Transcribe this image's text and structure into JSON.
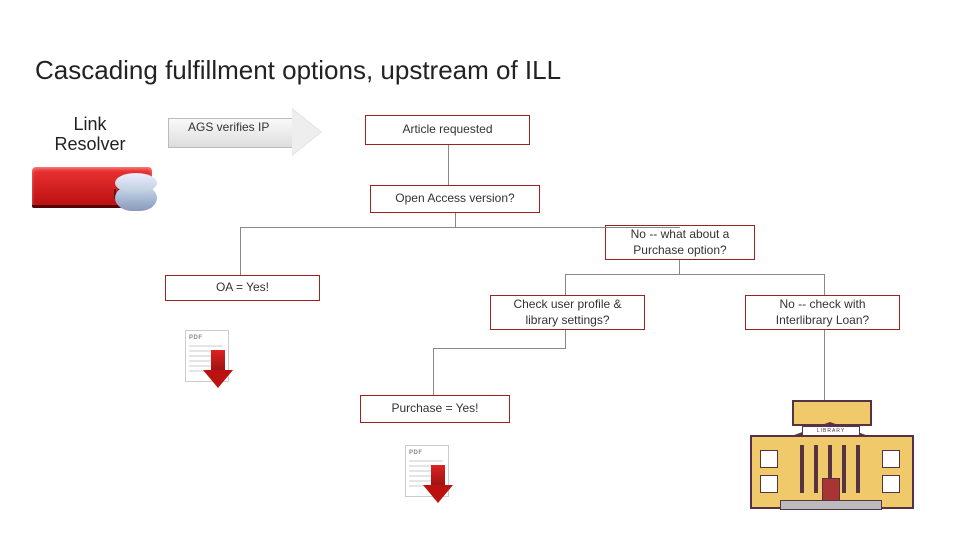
{
  "title": "Cascading fulfillment options, upstream of ILL",
  "link_resolver_label": "Link Resolver",
  "ags_label": "AGS verifies IP",
  "library_sign": "LIBRARY",
  "nodes": {
    "article_requested": "Article requested",
    "open_access_q": "Open Access version?",
    "no_purchase_q": "No -- what about a Purchase option?",
    "oa_yes": "OA = Yes!",
    "check_profile": "Check user profile & library settings?",
    "no_ill": "No -- check with Interlibrary Loan?",
    "purchase_yes": "Purchase = Yes!"
  }
}
